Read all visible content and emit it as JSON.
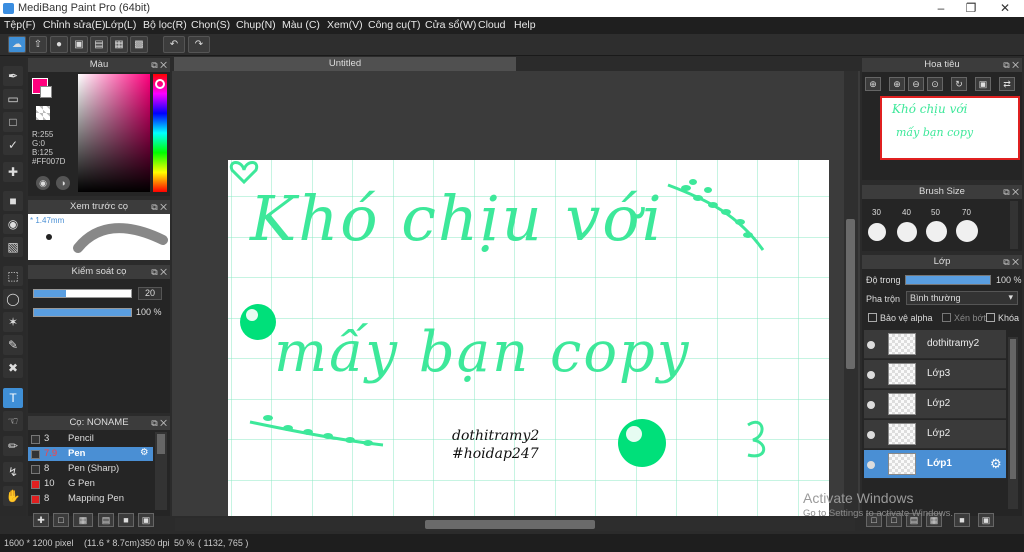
{
  "app": {
    "title": "MediBang Paint Pro (64bit)"
  },
  "menu": [
    "Tệp(F)",
    "Chỉnh sửa(E)",
    "Lớp(L)",
    "Bộ lọc(R)",
    "Chọn(S)",
    "Chụp(N)",
    "Màu (C)",
    "Xem(V)",
    "Công cụ(T)",
    "Cửa sổ(W)",
    "Cloud",
    "Help"
  ],
  "panels": {
    "color": {
      "title": "Màu",
      "r": "R:255",
      "g": "G:0",
      "b": "B:125",
      "hex": "#FF007D",
      "primary": "#ff007d"
    },
    "preview": {
      "title": "Xem trước cọ",
      "size": "1.47mm"
    },
    "brushctrl": {
      "title": "Kiểm soát cọ",
      "size": "20",
      "opacity": "100 %",
      "size_fill": 0.33,
      "opacity_fill": 1.0
    },
    "brushlist": {
      "title": "Cọ: NONAME",
      "items": [
        {
          "size": "3",
          "name": "Pencil",
          "color": "#333333"
        },
        {
          "size": "7.9",
          "name": "Pen",
          "color": "#333333"
        },
        {
          "size": "8",
          "name": "Pen (Sharp)",
          "color": "#333333"
        },
        {
          "size": "10",
          "name": "G Pen",
          "color": "#e02020"
        },
        {
          "size": "8",
          "name": "Mapping Pen",
          "color": "#e02020"
        }
      ]
    },
    "navigator": {
      "title": "Hoa tiêu"
    },
    "brushsize": {
      "title": "Brush Size",
      "sizes": [
        "30",
        "40",
        "50",
        "70"
      ]
    },
    "layer": {
      "title": "Lớp",
      "opacity_label": "Độ trong",
      "opacity": "100 %",
      "blend_label": "Pha trộn",
      "blend": "Bình thường",
      "protect_alpha": "Bảo vệ alpha",
      "clip": "Xén bớt",
      "lock": "Khóa",
      "layers": [
        "dothitramy2",
        "Lớp3",
        "Lớp2",
        "Lớp2",
        "Lớp1"
      ]
    }
  },
  "document": {
    "tab": "Untitled",
    "text_line1": "Khó chịu với",
    "text_line2": "mấy bạn copy",
    "sig1": "dothitramy2",
    "sig2": "#hoidap247"
  },
  "status": {
    "size": "1600 * 1200 pixel",
    "cm": "(11.6 * 8.7cm)",
    "dpi": "350 dpi",
    "zoom": "50 %",
    "coords": "( 1132, 765 )"
  },
  "watermark": {
    "line1": "Activate Windows",
    "line2": "Go to Settings to activate Windows."
  },
  "colors": {
    "accent": "#3f8fd6",
    "ink": "#3de89a"
  }
}
